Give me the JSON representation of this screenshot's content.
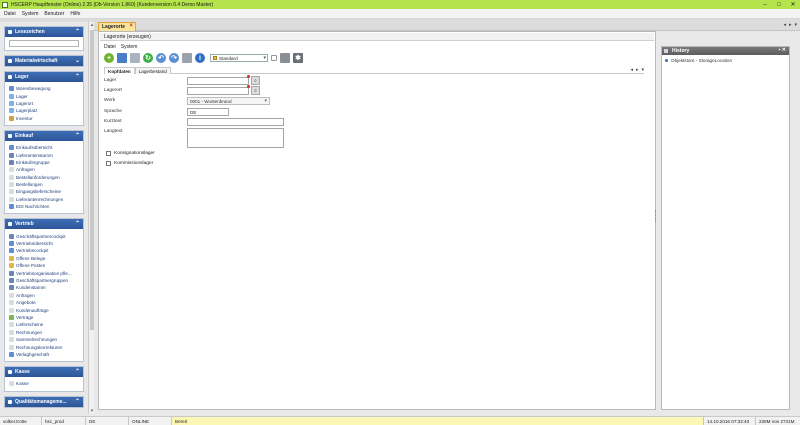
{
  "window": {
    "title": "HSCERP Hauptfenster (Online) 2.35 (Db-Version 1.860) (Kundenversion 0.4 Demo Master)",
    "controls": [
      "–",
      "□",
      "✕"
    ]
  },
  "menubar": [
    "Datei",
    "System",
    "Benutzer",
    "Hilfe"
  ],
  "tab": {
    "label": "Lagerorte",
    "close": "×"
  },
  "strip_controls": [
    "◂",
    "▸",
    "▾"
  ],
  "sidebar": {
    "panels": [
      {
        "title": "Lesezeichen",
        "items": [],
        "has_input": true
      },
      {
        "title": "Materialwirtschaft",
        "items": []
      },
      {
        "title": "Lager",
        "items": [
          "Warenbewegung",
          "Lager",
          "Lagerort",
          "Lagerplatz",
          "Inventur"
        ]
      },
      {
        "title": "Einkauf",
        "items": [
          "Einkaufsübersicht",
          "Lieferantenstamm",
          "Einkäufergruppe",
          "Anfragen",
          "Bestellanforderungen",
          "Bestellungen",
          "Eingangslieferscheine",
          "Lieferantenrechnungen",
          "EDI Nachrichten"
        ]
      },
      {
        "title": "Vertrieb",
        "items": [
          "Geschäftspartnercockpit",
          "Vertriebsübersicht",
          "Vertriebscockpit",
          "Offene Belege",
          "Offene Posten",
          "Vertriebsorganisation pfle...",
          "Geschäftspartnergruppen",
          "Kundenstamm",
          "Anfragen",
          "Angebote",
          "Kundenaufträge",
          "Verträge",
          "Lieferscheine",
          "Rechnungen",
          "Sammelrechnungen",
          "Rechnungskorrekturen",
          "Verlaghgeschäft"
        ]
      },
      {
        "title": "Kasse",
        "items": [
          "Kasse"
        ]
      },
      {
        "title": "Qualitätsmanageme...",
        "items": []
      }
    ]
  },
  "breadcrumb": "Lagerorte (erzeugen)",
  "submenu": [
    "Datei",
    "System"
  ],
  "toolbar": {
    "select_value": "Standard"
  },
  "form_tabs": [
    "Kopfdaten",
    "Lagerbestand"
  ],
  "form": {
    "lager_label": "Lager",
    "lagerort_label": "Lagerort",
    "werk_label": "Werk",
    "werk_value": "0001 - Wustenbrand",
    "sprache_label": "Sprache",
    "sprache_value": "DE",
    "kurztext_label": "Kurztext",
    "langtext_label": "Langtext",
    "konsignationslager": "Konsignationslager",
    "kommissionslager": "Kommissionslager"
  },
  "history": {
    "title": "History",
    "items": [
      "Objektstore - StorageLocation"
    ]
  },
  "statusbar": {
    "user": "volker.trotte",
    "db": "hsc_prod",
    "lang": "DE",
    "mode": "ONLINE",
    "status": "Bereit",
    "datetime": "14.10.2016 07:32:40",
    "memory": "236M von 2731M"
  }
}
